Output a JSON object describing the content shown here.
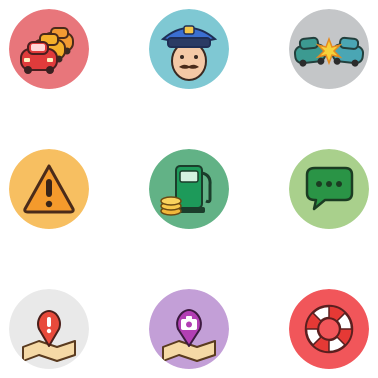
{
  "icons": [
    {
      "id": "traffic-jam",
      "icon": "traffic-jam-icon",
      "color": "#e8767b"
    },
    {
      "id": "police",
      "icon": "police-officer-icon",
      "color": "#7fc8d3"
    },
    {
      "id": "accident",
      "icon": "car-crash-icon",
      "color": "#c4c6c8"
    },
    {
      "id": "hazard",
      "icon": "warning-icon",
      "color": "#f7bf61"
    },
    {
      "id": "gas-station",
      "icon": "gas-pump-icon",
      "color": "#62b286"
    },
    {
      "id": "chat",
      "icon": "chat-bubble-icon",
      "color": "#a9d08c"
    },
    {
      "id": "map-issue",
      "icon": "map-alert-icon",
      "color": "#e9e9e9"
    },
    {
      "id": "map-photo",
      "icon": "map-camera-icon",
      "color": "#c39fd7"
    },
    {
      "id": "help",
      "icon": "lifebuoy-icon",
      "color": "#f1565a"
    }
  ]
}
